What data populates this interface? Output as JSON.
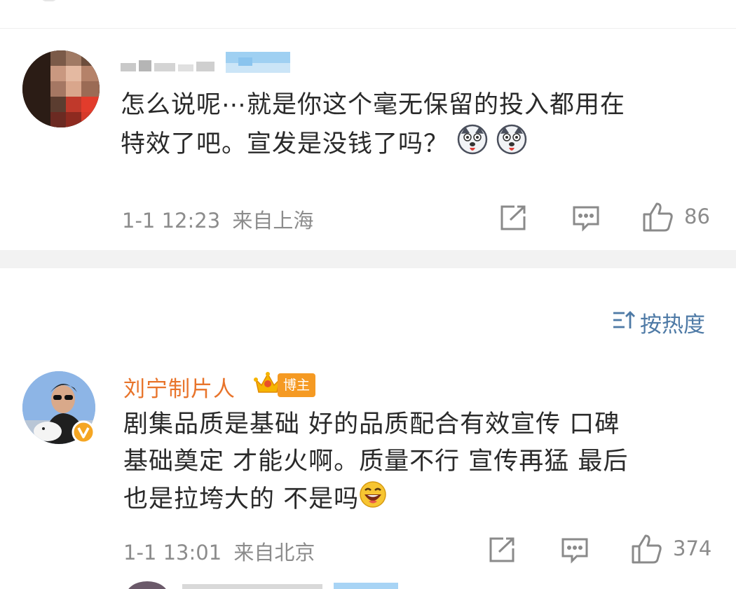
{
  "comments": [
    {
      "text_line1": "怎么说呢⋯就是你这个毫无保留的投入都用在",
      "text_line2": "特效了吧。宣发是没钱了吗？",
      "date": "1-1 12:23",
      "location": "来自上海",
      "likes": "86"
    },
    {
      "author": "刘宁制片人",
      "badge": "博主",
      "text_line1": "剧集品质是基础 好的品质配合有效宣传 口碑",
      "text_line2": "基础奠定 才能火啊。质量不行 宣传再猛 最后",
      "text_line3": "也是拉垮大的 不是吗",
      "date": "1-1 13:01",
      "location": "来自北京",
      "likes": "374"
    }
  ],
  "sort": {
    "label": "按热度"
  },
  "colors": {
    "author_orange": "#e8742b",
    "link_blue": "#4e7aa6",
    "meta_gray": "#8c8c8c",
    "band_gray": "#f2f2f2"
  },
  "icons": [
    "share-icon",
    "comment-icon",
    "thumbs-up-icon",
    "sort-icon",
    "crown-badge-icon",
    "verified-v-icon",
    "husky-emoji-icon",
    "laugh-emoji-icon"
  ]
}
